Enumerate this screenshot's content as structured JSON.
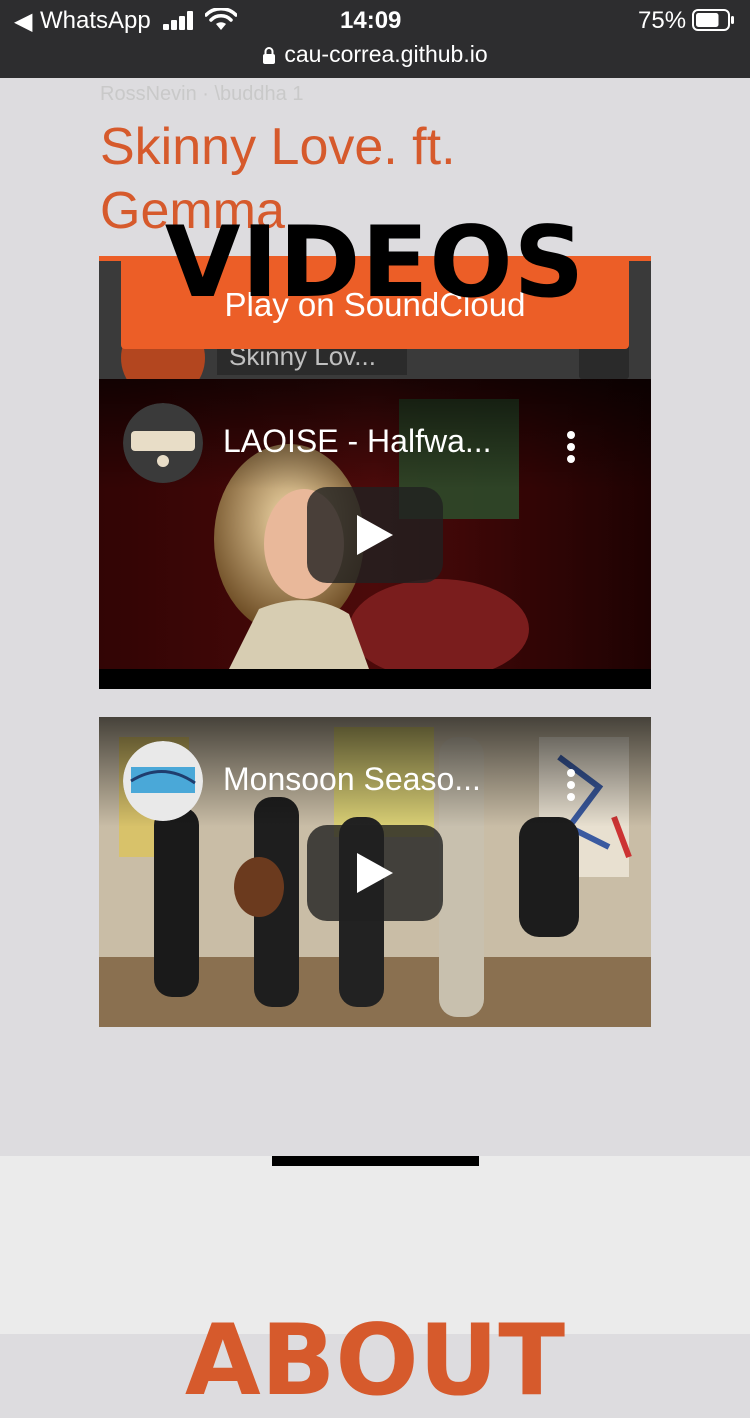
{
  "status_bar": {
    "back_app": "WhatsApp",
    "time": "14:09",
    "battery_percent": "75%",
    "battery_level": 0.75,
    "url": "cau-correa.github.io"
  },
  "soundcloud": {
    "meta": "RossNevin · \\buddha 1",
    "title": "Skinny Love. ft. Gemma",
    "button_label": "Play on SoundCloud",
    "track_label": "Skinny Lov..."
  },
  "videos": {
    "heading": "VIDEOS",
    "items": [
      {
        "title": "LAOISE - Halfwa...",
        "channel_icon": "ruby-sessions-logo"
      },
      {
        "title": "Monsoon Seaso...",
        "channel_icon": "beach-art-logo"
      }
    ]
  },
  "about": {
    "heading": "ABOUT"
  },
  "colors": {
    "accent": "#d65a2c",
    "soundcloud": "#ec5e27",
    "background": "#dddcdf"
  }
}
